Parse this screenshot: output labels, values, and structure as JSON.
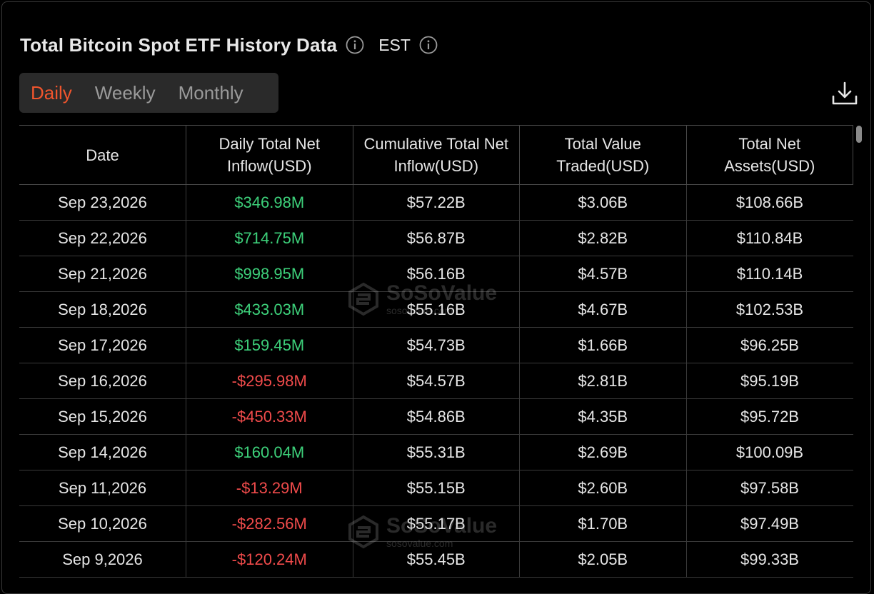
{
  "header": {
    "title": "Total Bitcoin Spot ETF History Data",
    "timezone": "EST"
  },
  "tabs": [
    {
      "label": "Daily",
      "active": true
    },
    {
      "label": "Weekly",
      "active": false
    },
    {
      "label": "Monthly",
      "active": false
    }
  ],
  "table": {
    "columns": [
      "Date",
      "Daily Total Net Inflow(USD)",
      "Cumulative Total Net Inflow(USD)",
      "Total Value Traded(USD)",
      "Total Net Assets(USD)"
    ],
    "rows": [
      {
        "date": "Sep 23,2026",
        "daily_inflow": "$346.98M",
        "direction": "positive",
        "cumulative": "$57.22B",
        "traded": "$3.06B",
        "net_assets": "$108.66B"
      },
      {
        "date": "Sep 22,2026",
        "daily_inflow": "$714.75M",
        "direction": "positive",
        "cumulative": "$56.87B",
        "traded": "$2.82B",
        "net_assets": "$110.84B"
      },
      {
        "date": "Sep 21,2026",
        "daily_inflow": "$998.95M",
        "direction": "positive",
        "cumulative": "$56.16B",
        "traded": "$4.57B",
        "net_assets": "$110.14B"
      },
      {
        "date": "Sep 18,2026",
        "daily_inflow": "$433.03M",
        "direction": "positive",
        "cumulative": "$55.16B",
        "traded": "$4.67B",
        "net_assets": "$102.53B"
      },
      {
        "date": "Sep 17,2026",
        "daily_inflow": "$159.45M",
        "direction": "positive",
        "cumulative": "$54.73B",
        "traded": "$1.66B",
        "net_assets": "$96.25B"
      },
      {
        "date": "Sep 16,2026",
        "daily_inflow": "-$295.98M",
        "direction": "negative",
        "cumulative": "$54.57B",
        "traded": "$2.81B",
        "net_assets": "$95.19B"
      },
      {
        "date": "Sep 15,2026",
        "daily_inflow": "-$450.33M",
        "direction": "negative",
        "cumulative": "$54.86B",
        "traded": "$4.35B",
        "net_assets": "$95.72B"
      },
      {
        "date": "Sep 14,2026",
        "daily_inflow": "$160.04M",
        "direction": "positive",
        "cumulative": "$55.31B",
        "traded": "$2.69B",
        "net_assets": "$100.09B"
      },
      {
        "date": "Sep 11,2026",
        "daily_inflow": "-$13.29M",
        "direction": "negative",
        "cumulative": "$55.15B",
        "traded": "$2.60B",
        "net_assets": "$97.58B"
      },
      {
        "date": "Sep 10,2026",
        "daily_inflow": "-$282.56M",
        "direction": "negative",
        "cumulative": "$55.17B",
        "traded": "$1.70B",
        "net_assets": "$97.49B"
      },
      {
        "date": "Sep 9,2026",
        "daily_inflow": "-$120.24M",
        "direction": "negative",
        "cumulative": "$55.45B",
        "traded": "$2.05B",
        "net_assets": "$99.33B"
      }
    ]
  },
  "watermark": {
    "brand": "SoSoValue",
    "url": "sosovalue.com"
  },
  "colors": {
    "positive": "#3dd07a",
    "negative": "#f04b4b",
    "accent": "#f0552d",
    "background": "#000000"
  },
  "icons": {
    "info": "info-circle-icon",
    "download": "download-icon",
    "watermark_logo": "sosovalue-logo-icon"
  }
}
